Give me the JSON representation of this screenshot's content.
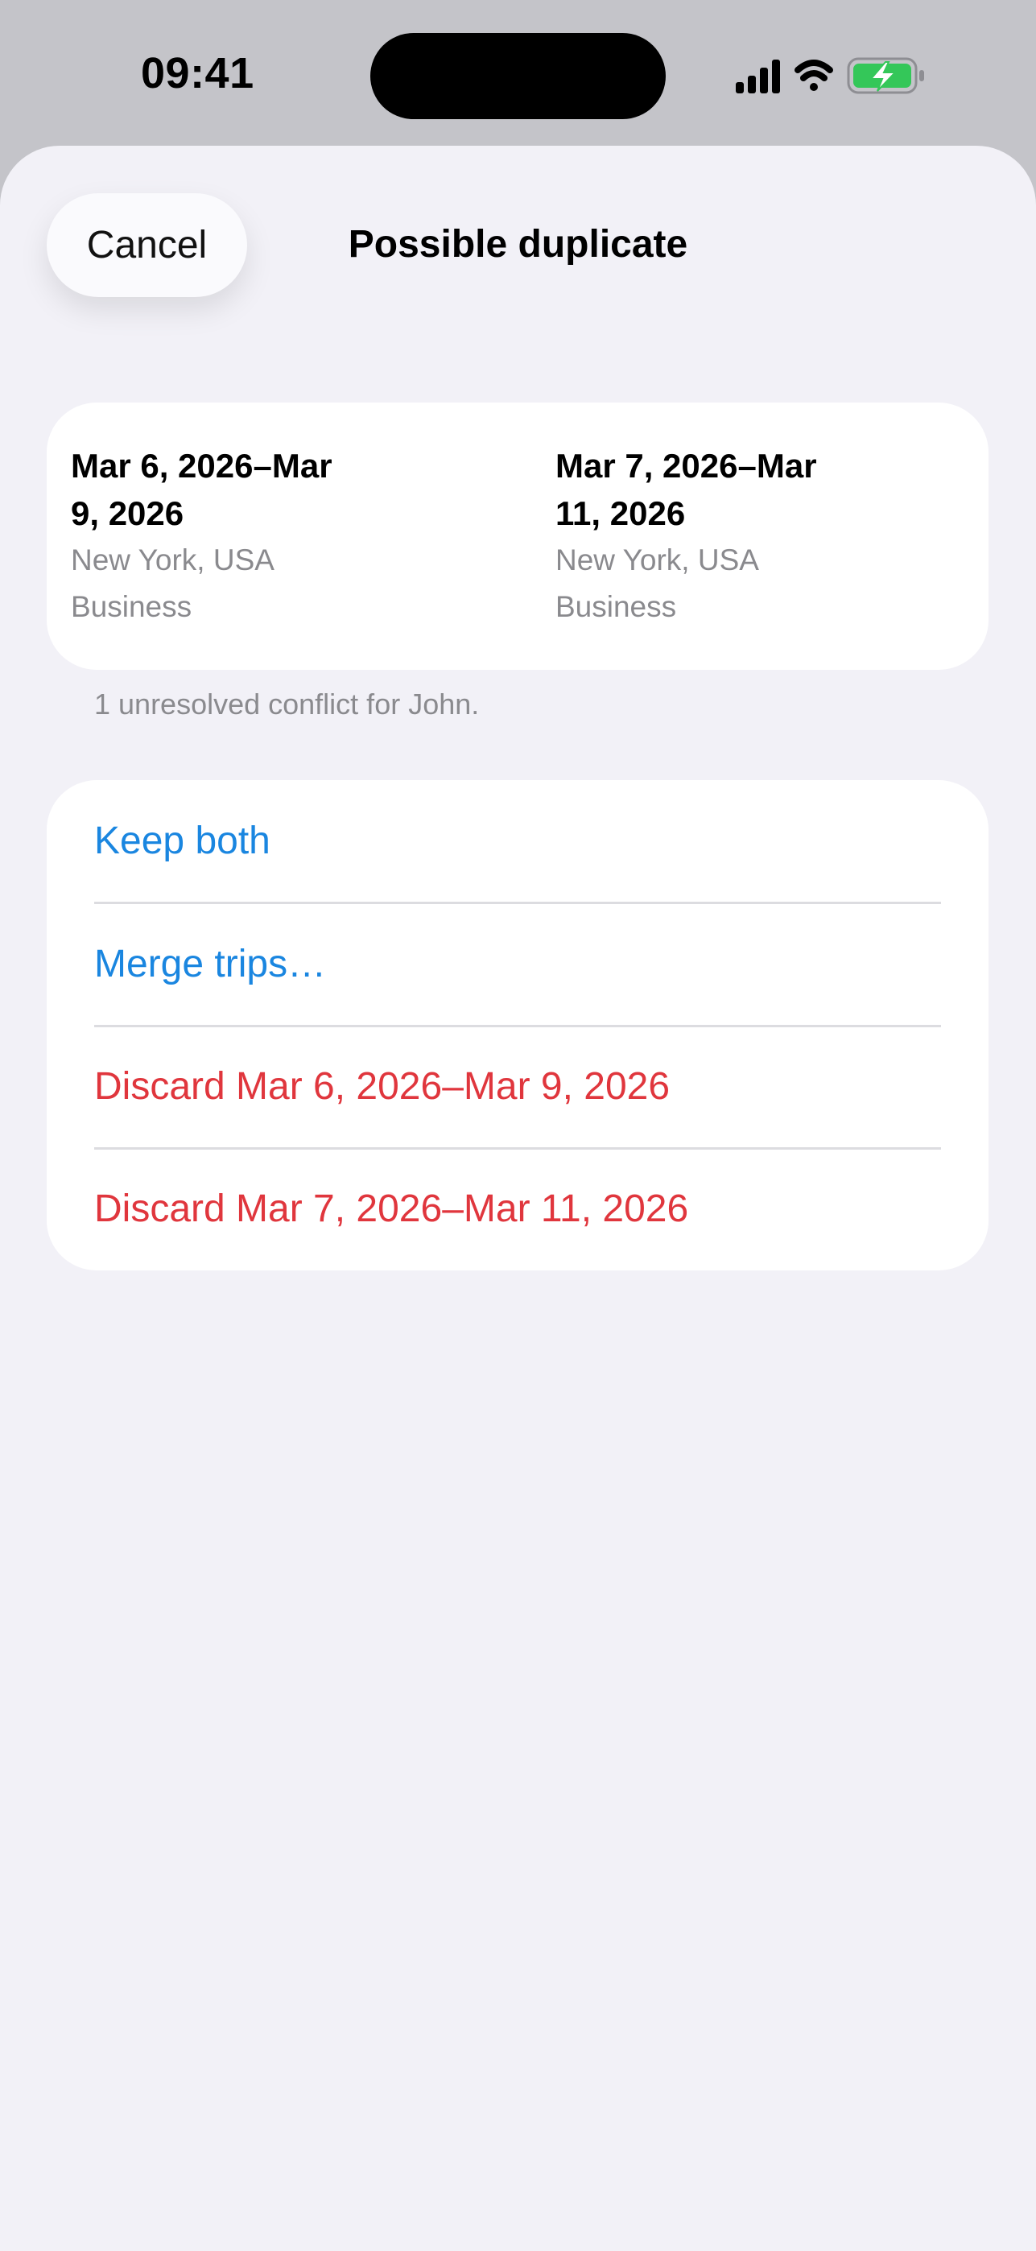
{
  "status_bar": {
    "time": "09:41",
    "icons": [
      "cellular-signal-icon",
      "wifi-icon",
      "battery-charging-icon"
    ]
  },
  "sheet": {
    "cancel_label": "Cancel",
    "title": "Possible duplicate",
    "trips": [
      {
        "dates_line1": "Mar 6, 2026–Mar",
        "dates_line2": "9, 2026",
        "location": "New York, USA",
        "purpose": "Business"
      },
      {
        "dates_line1": "Mar 7, 2026–Mar",
        "dates_line2": "11, 2026",
        "location": "New York, USA",
        "purpose": "Business"
      }
    ],
    "footnote": "1 unresolved conflict for John.",
    "actions": [
      {
        "label": "Keep both",
        "style": "default"
      },
      {
        "label": "Merge trips…",
        "style": "default"
      },
      {
        "label": "Discard Mar 6, 2026–Mar 9, 2026",
        "style": "destructive"
      },
      {
        "label": "Discard Mar 7, 2026–Mar 11, 2026",
        "style": "destructive"
      }
    ]
  },
  "colors": {
    "accent": "#1a86e0",
    "destructive": "#e0363d",
    "battery_charging": "#34c759",
    "sheet_background": "#f2f1f7"
  }
}
